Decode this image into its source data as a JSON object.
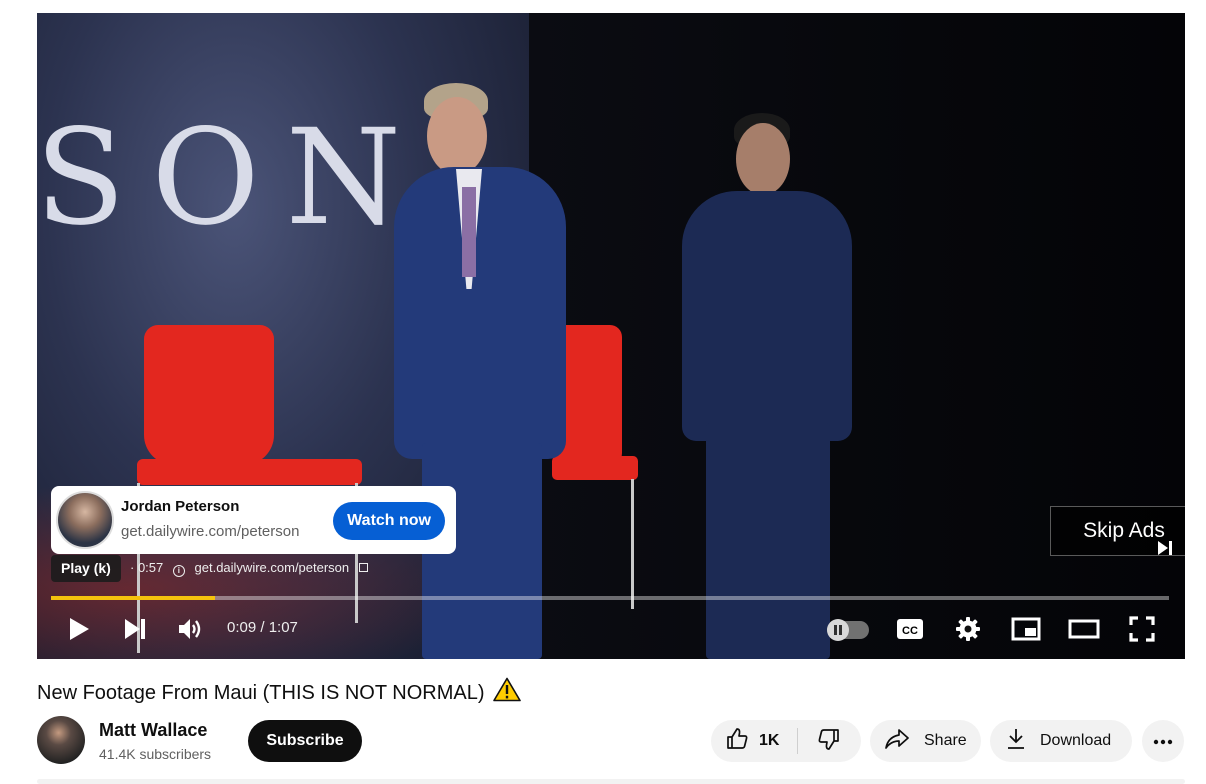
{
  "player": {
    "backdrop_text": "SON",
    "ad": {
      "name": "Jordan Peterson",
      "url": "get.dailywire.com/peterson",
      "cta": "Watch now",
      "remaining": "0:57",
      "info_url": "get.dailywire.com/peterson"
    },
    "tooltip": "Play (k)",
    "skip_label": "Skip Ads",
    "progress": 0.147,
    "time": "0:09 / 1:07",
    "accent": "#f4c20d",
    "icons": [
      "play-icon",
      "next-icon",
      "volume-icon",
      "autoplay-toggle",
      "captions-icon",
      "settings-icon",
      "miniplayer-icon",
      "theater-icon",
      "fullscreen-icon"
    ]
  },
  "video": {
    "title": "New Footage From Maui (THIS IS NOT NORMAL)",
    "warning_icon": "warning-icon"
  },
  "channel": {
    "name": "Matt Wallace",
    "subscribers": "41.4K subscribers",
    "subscribe_label": "Subscribe"
  },
  "actions": {
    "likes": "1K",
    "share_label": "Share",
    "download_label": "Download"
  }
}
